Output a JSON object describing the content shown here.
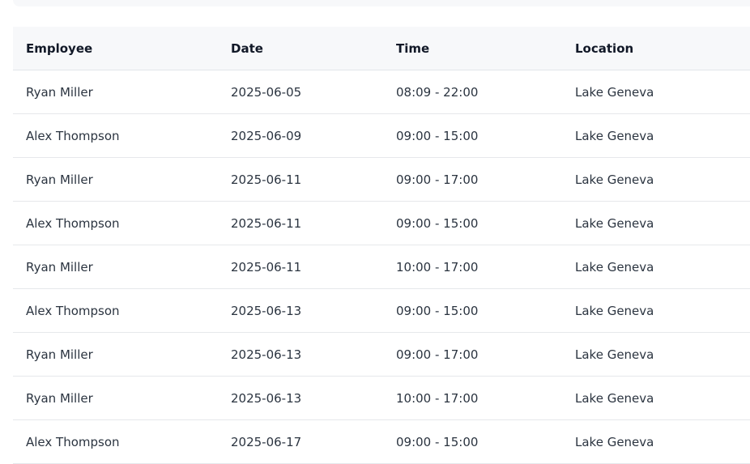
{
  "table": {
    "headers": {
      "employee": "Employee",
      "date": "Date",
      "time": "Time",
      "location": "Location"
    },
    "rows": [
      {
        "employee": "Ryan Miller",
        "date": "2025-06-05",
        "time": "08:09 - 22:00",
        "location": "Lake Geneva"
      },
      {
        "employee": "Alex Thompson",
        "date": "2025-06-09",
        "time": "09:00 - 15:00",
        "location": "Lake Geneva"
      },
      {
        "employee": "Ryan Miller",
        "date": "2025-06-11",
        "time": "09:00 - 17:00",
        "location": "Lake Geneva"
      },
      {
        "employee": "Alex Thompson",
        "date": "2025-06-11",
        "time": "09:00 - 15:00",
        "location": "Lake Geneva"
      },
      {
        "employee": "Ryan Miller",
        "date": "2025-06-11",
        "time": "10:00 - 17:00",
        "location": "Lake Geneva"
      },
      {
        "employee": "Alex Thompson",
        "date": "2025-06-13",
        "time": "09:00 - 15:00",
        "location": "Lake Geneva"
      },
      {
        "employee": "Ryan Miller",
        "date": "2025-06-13",
        "time": "09:00 - 17:00",
        "location": "Lake Geneva"
      },
      {
        "employee": "Ryan Miller",
        "date": "2025-06-13",
        "time": "10:00 - 17:00",
        "location": "Lake Geneva"
      },
      {
        "employee": "Alex Thompson",
        "date": "2025-06-17",
        "time": "09:00 - 15:00",
        "location": "Lake Geneva"
      }
    ]
  }
}
